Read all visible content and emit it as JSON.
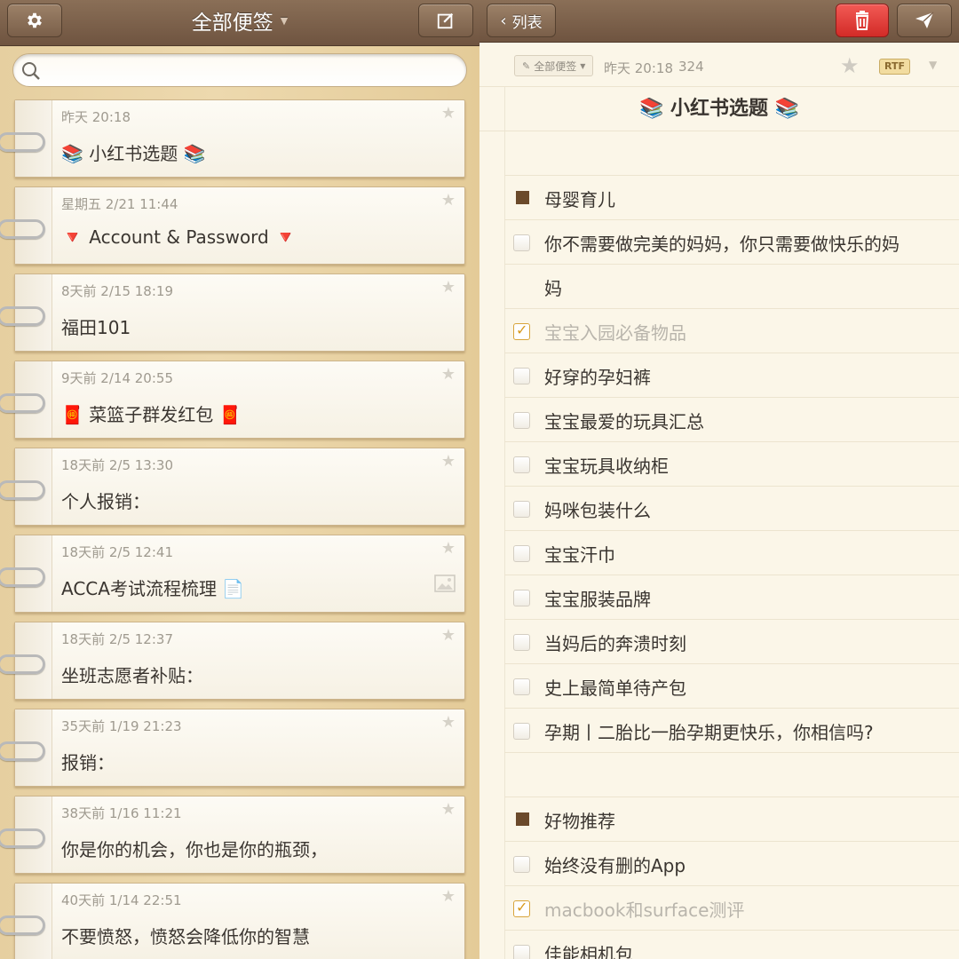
{
  "left": {
    "title": "全部便签",
    "search_placeholder": "",
    "notes": [
      {
        "date": "昨天 20:18",
        "title": "📚 小红书选题 📚"
      },
      {
        "date": "星期五 2/21  11:44",
        "title": "🔻 Account & Password 🔻"
      },
      {
        "date": "8天前 2/15  18:19",
        "title": "福田101"
      },
      {
        "date": "9天前 2/14  20:55",
        "title": "🧧 菜篮子群发红包 🧧"
      },
      {
        "date": "18天前 2/5  13:30",
        "title": "个人报销："
      },
      {
        "date": "18天前 2/5  12:41",
        "title": "ACCA考试流程梳理 📄"
      },
      {
        "date": "18天前 2/5  12:37",
        "title": "坐班志愿者补贴："
      },
      {
        "date": "35天前 1/19  21:23",
        "title": "报销："
      },
      {
        "date": "38天前 1/16  11:21",
        "title": "你是你的机会，你也是你的瓶颈，"
      },
      {
        "date": "40天前 1/14  22:51",
        "title": "不要愤怒，愤怒会降低你的智慧"
      }
    ]
  },
  "right": {
    "back_label": "列表",
    "folder_chip": "全部便签",
    "date": "昨天 20:18",
    "char_count": "324",
    "format_badge": "RTF",
    "doc_title": "📚 小红书选题 📚",
    "sections": [
      {
        "heading": "母婴育儿",
        "items": [
          {
            "text": "你不需要做完美的妈妈，你只需要做快乐的妈",
            "cont": "妈",
            "checked": false
          },
          {
            "text": "宝宝入园必备物品",
            "checked": true
          },
          {
            "text": "好穿的孕妇裤",
            "checked": false
          },
          {
            "text": "宝宝最爱的玩具汇总",
            "checked": false
          },
          {
            "text": "宝宝玩具收纳柜",
            "checked": false
          },
          {
            "text": "妈咪包装什么",
            "checked": false
          },
          {
            "text": "宝宝汗巾",
            "checked": false
          },
          {
            "text": "宝宝服装品牌",
            "checked": false
          },
          {
            "text": "当妈后的奔溃时刻",
            "checked": false
          },
          {
            "text": "史上最简单待产包",
            "checked": false
          },
          {
            "text": "孕期丨二胎比一胎孕期更快乐，你相信吗?",
            "checked": false
          }
        ]
      },
      {
        "heading": "好物推荐",
        "items": [
          {
            "text": "始终没有删的App",
            "checked": false
          },
          {
            "text": "macbook和surface测评",
            "checked": true
          },
          {
            "text": "佳能相机包",
            "checked": false
          }
        ]
      }
    ]
  },
  "colors": {
    "toolbar": "#7a5f49",
    "delete_red": "#e0403b",
    "heading_square": "#6b4a2b",
    "check_orange": "#d89a1e"
  }
}
